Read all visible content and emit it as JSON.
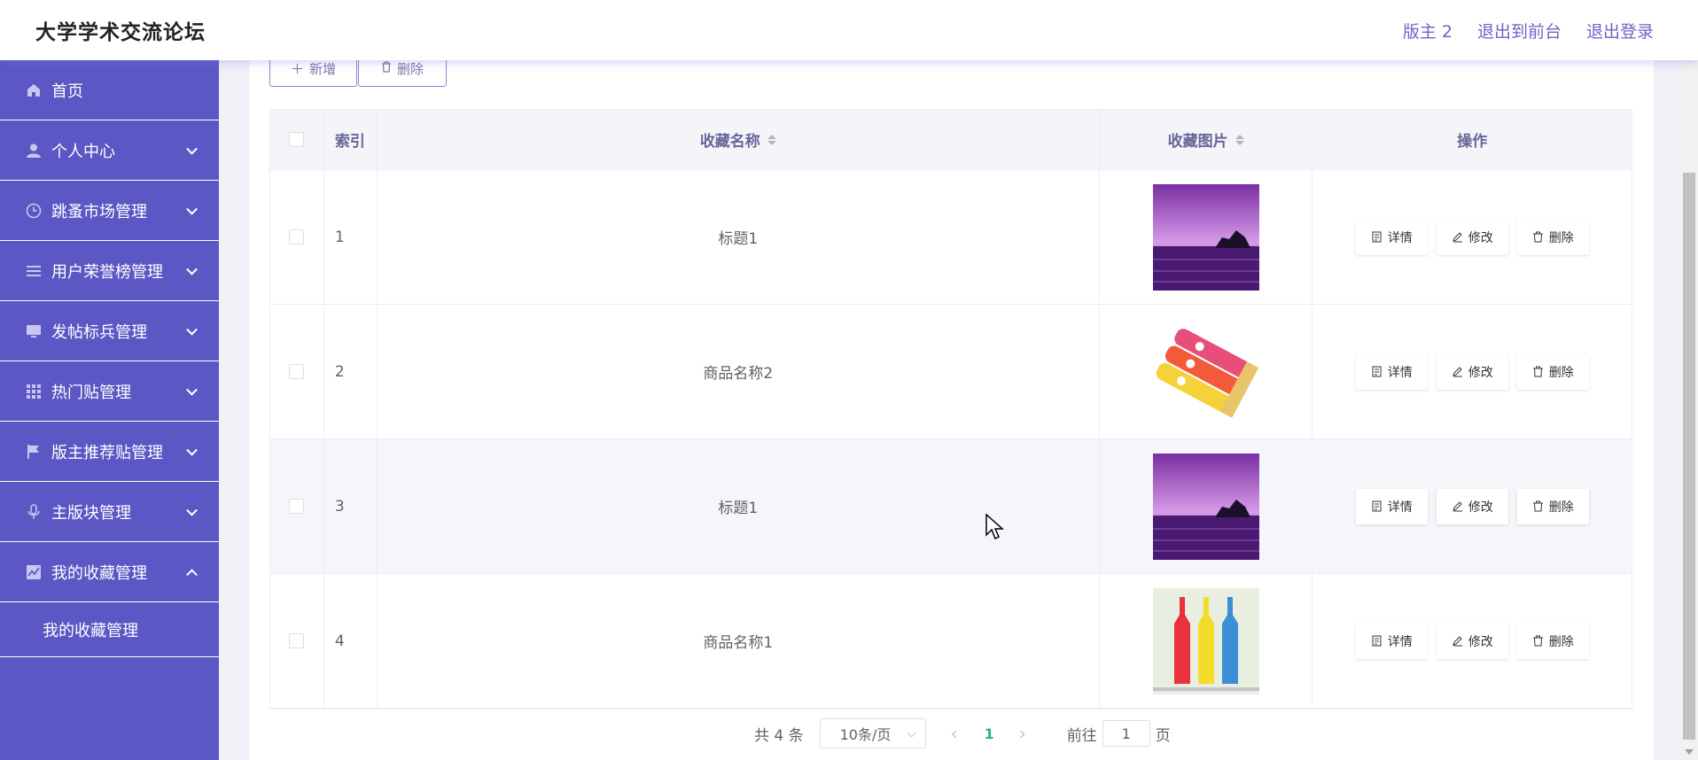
{
  "header": {
    "title": "大学学术交流论坛",
    "user": "版主 2",
    "to_front": "退出到前台",
    "logout": "退出登录"
  },
  "sidebar": {
    "items": [
      {
        "label": "首页",
        "icon": "home-icon"
      },
      {
        "label": "个人中心",
        "icon": "user-icon"
      },
      {
        "label": "跳蚤市场管理",
        "icon": "clock-icon"
      },
      {
        "label": "用户荣誉榜管理",
        "icon": "menu-icon"
      },
      {
        "label": "发帖标兵管理",
        "icon": "monitor-icon"
      },
      {
        "label": "热门贴管理",
        "icon": "grid-icon"
      },
      {
        "label": "版主推荐贴管理",
        "icon": "flag-icon"
      },
      {
        "label": "主版块管理",
        "icon": "mic-icon"
      },
      {
        "label": "我的收藏管理",
        "icon": "chart-icon"
      }
    ],
    "submenu": "我的收藏管理"
  },
  "toolbar": {
    "add": "新增",
    "delete": "删除"
  },
  "table": {
    "headers": {
      "index": "索引",
      "name": "收藏名称",
      "image": "收藏图片",
      "ops": "操作"
    },
    "rows": [
      {
        "index": "1",
        "name": "标题1",
        "image": "purple-sunset-sea"
      },
      {
        "index": "2",
        "name": "商品名称2",
        "image": "pringles-cans"
      },
      {
        "index": "3",
        "name": "标题1",
        "image": "purple-sunset-sea"
      },
      {
        "index": "4",
        "name": "商品名称1",
        "image": "colorful-bottles"
      }
    ],
    "ops": {
      "detail": "详情",
      "edit": "修改",
      "delete": "删除"
    }
  },
  "pagination": {
    "total": "共 4 条",
    "page_size": "10条/页",
    "current": "1",
    "goto": "前往",
    "goto_value": "1",
    "page_unit": "页"
  },
  "colors": {
    "sidebar": "#5b57c4",
    "accent": "#6a66c8",
    "page_active": "#2bb673"
  }
}
